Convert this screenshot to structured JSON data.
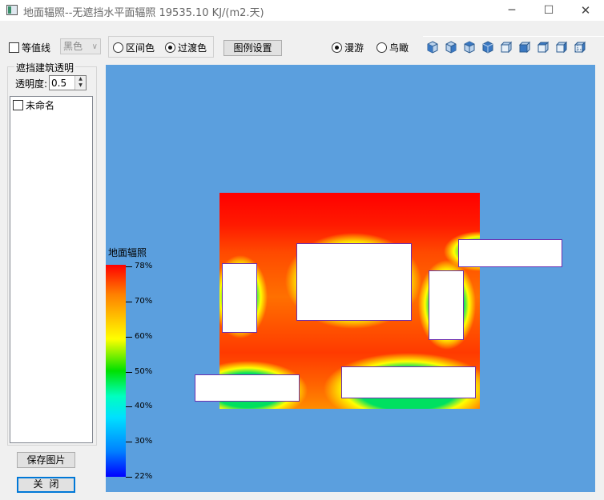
{
  "window": {
    "title": "地面辐照--无遮挡水平面辐照 19535.10 KJ/(m2.天)",
    "min_glyph": "─",
    "max_glyph": "☐",
    "close_glyph": "✕"
  },
  "toolbar": {
    "contour_label": "等值线",
    "contour_checked": false,
    "color_select_value": "黑色",
    "radio_interval_label": "区间色",
    "radio_gradient_label": "过渡色",
    "selected_color_mode": "过渡色",
    "legend_settings_label": "图例设置",
    "radio_roam_label": "漫游",
    "radio_birdseye_label": "鸟瞰",
    "selected_view_mode": "漫游",
    "view_icons": [
      "iso-view-icon",
      "front-view-icon",
      "left-view-icon",
      "right-view-icon",
      "back-view-icon",
      "top-view-icon",
      "bottom-view-icon",
      "side-view-icon",
      "perspective-view-icon"
    ]
  },
  "left_panel": {
    "group_title": "遮挡建筑透明",
    "transparency_label": "透明度:",
    "transparency_value": "0.5",
    "buildings": [
      {
        "label": "未命名",
        "checked": false
      }
    ],
    "save_image_label": "保存图片",
    "close_label": "关闭"
  },
  "colorbar": {
    "title": "地面辐照",
    "ticks": [
      "78%",
      "70%",
      "60%",
      "50%",
      "40%",
      "30%",
      "22%"
    ],
    "colors": [
      "#ff0000",
      "#ff8000",
      "#ffff00",
      "#00e000",
      "#00e0ff",
      "#0080ff",
      "#0000ff"
    ]
  },
  "colors": {
    "canvas_bg": "#5b9fde",
    "building_outline": "#6b2fb0",
    "focus_border": "#0078d7"
  }
}
